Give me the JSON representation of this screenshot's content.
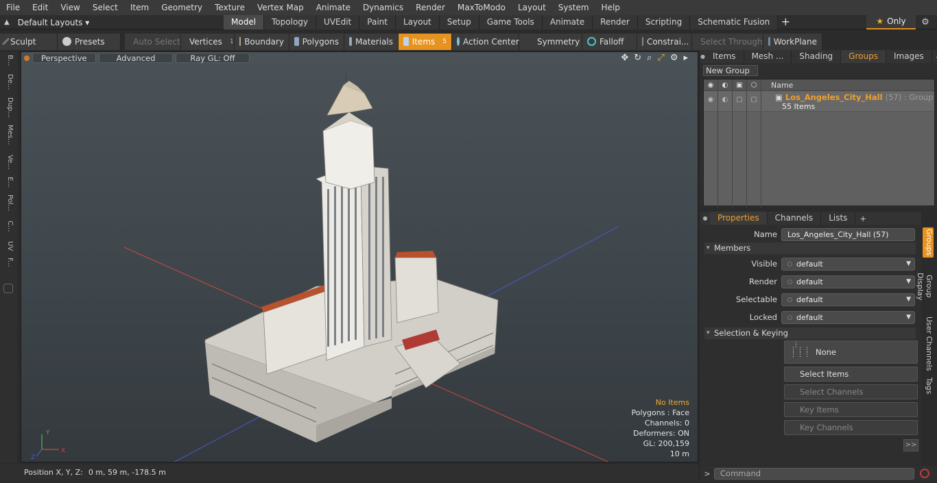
{
  "menu": [
    "File",
    "Edit",
    "View",
    "Select",
    "Item",
    "Geometry",
    "Texture",
    "Vertex Map",
    "Animate",
    "Dynamics",
    "Render",
    "MaxToModo",
    "Layout",
    "System",
    "Help"
  ],
  "layout_dropdown": "Default Layouts ▾",
  "layout_tabs": [
    {
      "label": "Model",
      "active": true
    },
    {
      "label": "Topology"
    },
    {
      "label": "UVEdit"
    },
    {
      "label": "Paint"
    },
    {
      "label": "Layout"
    },
    {
      "label": "Setup"
    },
    {
      "label": "Game Tools"
    },
    {
      "label": "Animate"
    },
    {
      "label": "Render"
    },
    {
      "label": "Scripting"
    },
    {
      "label": "Schematic Fusion"
    }
  ],
  "only_label": "Only",
  "toolbar": {
    "sculpt": "Sculpt",
    "presets": "Presets",
    "auto_select": "Auto Select",
    "vertices": "Vertices",
    "vertices_count": "1",
    "boundary": "Boundary",
    "polygons": "Polygons",
    "materials": "Materials",
    "items": "Items",
    "items_count": "5",
    "action_center": "Action Center",
    "symmetry": "Symmetry",
    "falloff": "Falloff",
    "constraints": "Constrai...",
    "select_through": "Select Through",
    "workplane": "WorkPlane"
  },
  "left_strip": [
    "B...",
    "De...",
    "Dup...",
    "Mes...",
    "Ve...",
    "E...",
    "Pol...",
    "C...",
    "UV",
    "F..."
  ],
  "viewport": {
    "perspective": "Perspective",
    "advanced": "Advanced",
    "raygl": "Ray GL: Off",
    "info": {
      "no_items": "No Items",
      "polygons": "Polygons : Face",
      "channels": "Channels: 0",
      "deformers": "Deformers: ON",
      "gl": "GL: 200,159",
      "scale": "10 m"
    },
    "axis": {
      "x": "X",
      "y": "Y",
      "z": "Z"
    }
  },
  "status": {
    "label": "Position X, Y, Z:",
    "value": "0 m, 59 m, -178.5 m"
  },
  "groups_panel": {
    "tabs": [
      {
        "label": "Items"
      },
      {
        "label": "Mesh ..."
      },
      {
        "label": "Shading"
      },
      {
        "label": "Groups",
        "active": true
      },
      {
        "label": "Images"
      }
    ],
    "new_group": "New Group",
    "name_header": "Name",
    "group_name": "Los_Angeles_City_Hall",
    "group_count": "(57) : Group",
    "group_items": "55 Items"
  },
  "properties": {
    "tabs": [
      {
        "label": "Properties",
        "active": true
      },
      {
        "label": "Channels"
      },
      {
        "label": "Lists"
      }
    ],
    "name_label": "Name",
    "name_value": "Los_Angeles_City_Hall (57)",
    "members_section": "Members",
    "visible_label": "Visible",
    "visible_value": "default",
    "render_label": "Render",
    "render_value": "default",
    "selectable_label": "Selectable",
    "selectable_value": "default",
    "locked_label": "Locked",
    "locked_value": "default",
    "selection_section": "Selection & Keying",
    "none_button": "None",
    "select_items": "Select Items",
    "select_channels": "Select Channels",
    "key_items": "Key Items",
    "key_channels": "Key Channels",
    "more": ">>"
  },
  "side_tabs": [
    "Groups",
    "Group Display",
    "User Channels",
    "Tags"
  ],
  "command_placeholder": "Command"
}
